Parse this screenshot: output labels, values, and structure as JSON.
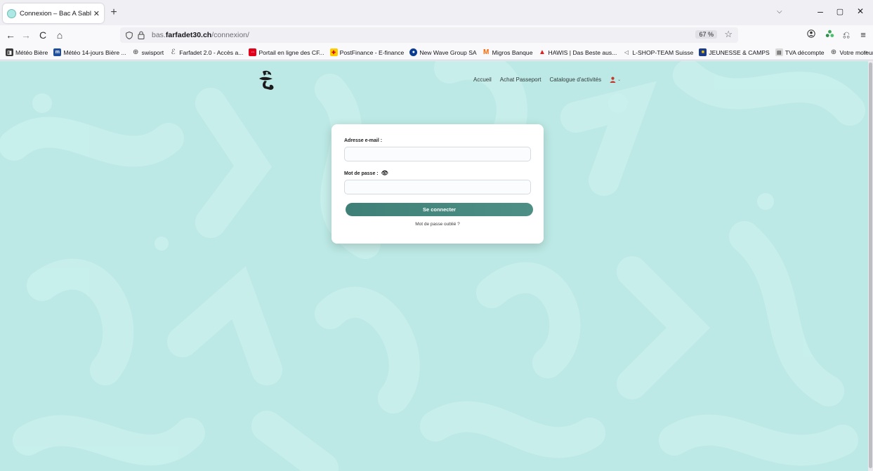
{
  "browser": {
    "tab_title": "Connexion – Bac A Sable – Pas",
    "tab_close": "✕",
    "new_tab": "+",
    "tabs_menu": "⌵",
    "window_controls": {
      "minimize": "–",
      "maximize": "▢",
      "close": "✕"
    },
    "nav": {
      "back": "←",
      "forward": "→",
      "reload": "C",
      "home": "⌂"
    },
    "url": {
      "prefix": "bas.",
      "domain": "farfadet30.ch",
      "path": "/connexion/"
    },
    "zoom": "67 %",
    "bookmarks": [
      {
        "label": "Météo Bière",
        "icon": "meteo-icon",
        "color": "#3a3a3a"
      },
      {
        "label": "Météo 14-jours Bière ...",
        "icon": "mb-icon",
        "color": "#1f4e9c"
      },
      {
        "label": "swisport",
        "icon": "globe-icon",
        "color": "#ffffff"
      },
      {
        "label": "Farfadet 2.0 - Accès a...",
        "icon": "farfadet-icon",
        "color": "#ffffff"
      },
      {
        "label": "Portail en ligne des CF...",
        "icon": "cff-icon",
        "color": "#e2001a"
      },
      {
        "label": "PostFinance - E-finance",
        "icon": "postfinance-icon",
        "color": "#ffcc00"
      },
      {
        "label": "New Wave Group SA",
        "icon": "newwave-icon",
        "color": "#0a3d91"
      },
      {
        "label": "Migros Banque",
        "icon": "migros-icon",
        "color": "#ff6600"
      },
      {
        "label": "HAWIS | Das Beste aus...",
        "icon": "hawis-icon",
        "color": "#e02020"
      },
      {
        "label": "L-SHOP-TEAM Suisse",
        "icon": "lshop-icon",
        "color": "#ffffff"
      },
      {
        "label": "JEUNESSE & CAMPS",
        "icon": "jeunesse-icon",
        "color": "#1a3a8a"
      },
      {
        "label": "TVA décompte",
        "icon": "tva-icon",
        "color": "#d9d9d9"
      },
      {
        "label": "Votre moteur de reche...",
        "icon": "globe-icon",
        "color": "#ffffff"
      }
    ],
    "bookmarks_more": "»"
  },
  "site": {
    "nav": {
      "accueil": "Accueil",
      "achat": "Achat Passeport",
      "catalogue": "Catalogue d'activités"
    },
    "login": {
      "email_label": "Adresse e-mail :",
      "email_value": "",
      "password_label": "Mot de passe :",
      "password_value": "",
      "submit_label": "Se connecter",
      "forgot_label": "Mot de passe oublié ?"
    }
  },
  "colors": {
    "page_background": "#bce9e5",
    "button": "#468880",
    "user_icon": "#c0392b"
  }
}
